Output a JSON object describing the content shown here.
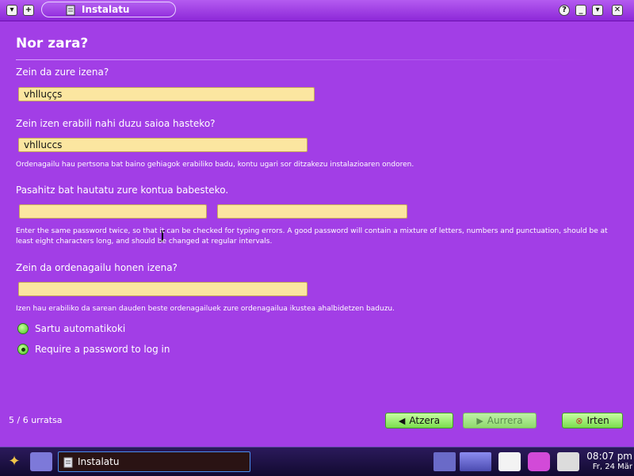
{
  "window": {
    "title": "Instalatu"
  },
  "page": {
    "heading": "Nor zara?",
    "name_question": "Zein da zure izena?",
    "name_value": "vhlluççs",
    "login_question": "Zein izen erabili nahi duzu saioa hasteko?",
    "login_value": "vhlluccs",
    "login_hint": "Ordenagailu hau pertsona bat baino gehiagok erabiliko badu, kontu ugari sor ditzakezu instalazioaren ondoren.",
    "password_question": "Pasahitz bat hautatu zure kontua babesteko.",
    "password_value": "",
    "password_confirm_value": "",
    "password_hint": "Enter the same password twice, so that it can be checked for typing errors. A good password will contain a mixture of letters, numbers and punctuation, should be at least eight characters long, and should be changed at regular intervals.",
    "computer_question": "Zein da ordenagailu honen izena?",
    "computer_value": "",
    "computer_hint": "Izen hau erabiliko da sarean dauden beste ordenagailuek zure ordenagailua ikustea ahalbidetzen baduzu.",
    "radio_auto": "Sartu automatikoki",
    "radio_password": "Require a password to log in",
    "selected_radio": "password"
  },
  "footer": {
    "step": "5 / 6 urratsa",
    "back_label": "Atzera",
    "forward_label": "Aurrera",
    "quit_label": "Irten"
  },
  "taskbar": {
    "task_label": "Instalatu",
    "time": "08:07 pm",
    "date": "Fr, 24 Mär"
  },
  "colors": {
    "background": "#a23ee6",
    "input": "#fbe6a0",
    "button": "#7adc4e"
  }
}
